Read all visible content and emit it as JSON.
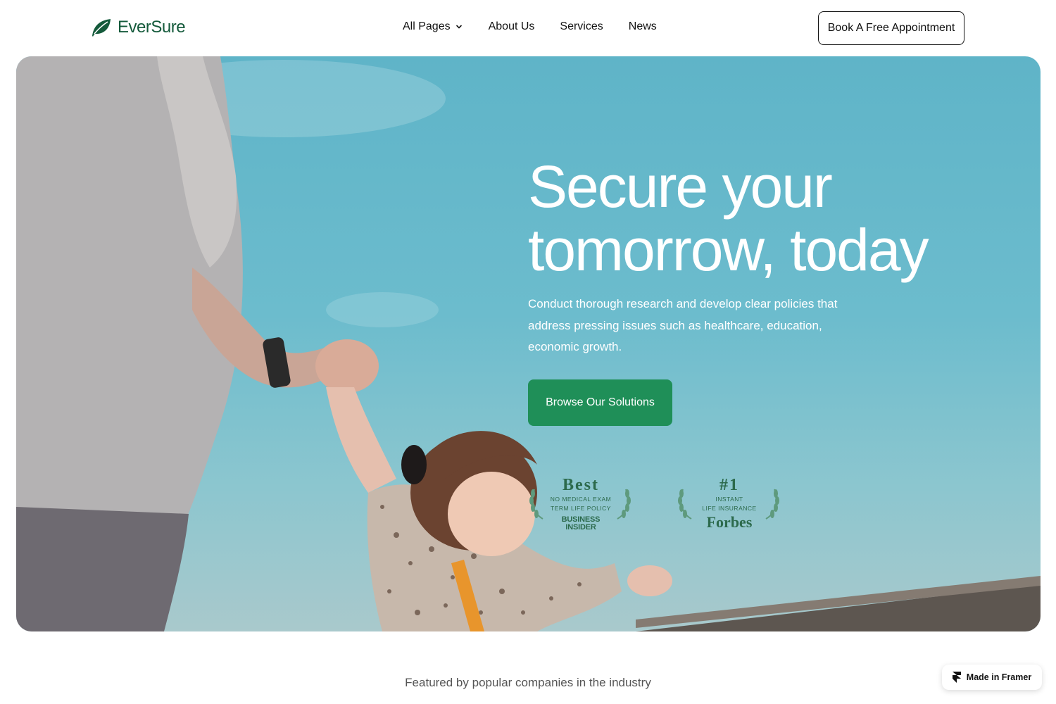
{
  "brand": {
    "name": "EverSure",
    "accent": "#1f8f58",
    "logo_color": "#145a3b"
  },
  "nav": {
    "items": [
      {
        "label": "All Pages",
        "has_dropdown": true
      },
      {
        "label": "About Us"
      },
      {
        "label": "Services"
      },
      {
        "label": "News"
      }
    ],
    "cta_label": "Book A Free Appointment"
  },
  "hero": {
    "title_line1": "Secure your",
    "title_line2": "tomorrow, today",
    "subtitle": "Conduct thorough research and develop clear policies that address pressing issues such as healthcare, education, economic growth.",
    "cta_label": "Browse Our Solutions"
  },
  "awards": [
    {
      "headline": "Best",
      "line1": "NO MEDICAL EXAM",
      "line2": "TERM LIFE POLICY",
      "brand_line1": "BUSINESS",
      "brand_line2": "INSIDER"
    },
    {
      "headline": "#1",
      "line1": "INSTANT",
      "line2": "LIFE INSURANCE",
      "brand": "Forbes"
    }
  ],
  "featured_text": "Featured by popular companies in the industry",
  "framer_badge": "Made in Framer",
  "icons": {
    "logo": "leaf-icon",
    "dropdown": "chevron-down-icon",
    "laurel": "laurel-icon",
    "framer": "framer-icon"
  }
}
